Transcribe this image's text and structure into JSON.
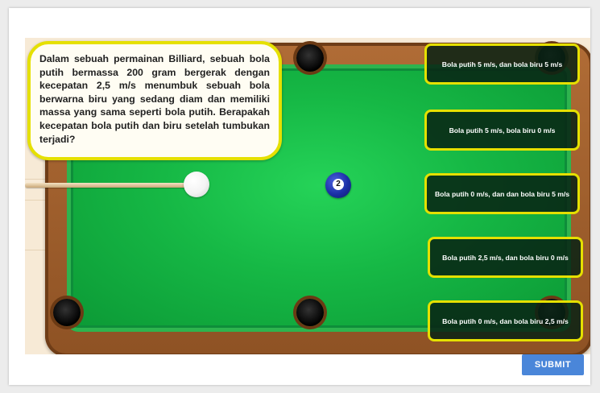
{
  "question": {
    "text": "Dalam sebuah permainan Billiard, sebuah bola putih bermassa 200 gram bergerak dengan kecepatan 2,5 m/s menumbuk sebuah bola berwarna biru yang sedang diam dan memiliki massa yang sama seperti bola putih. Berapakah kecepatan bola putih dan biru setelah tumbukan terjadi?"
  },
  "ball_number": "2",
  "answers": [
    {
      "label": "Bola putih 5 m/s, dan bola biru 5 m/s"
    },
    {
      "label": "Bola putih 5 m/s, bola biru 0 m/s"
    },
    {
      "label": "Bola putih 0 m/s, dan dan bola biru 5 m/s"
    },
    {
      "label": "Bola putih 2,5 m/s, dan bola biru 0 m/s"
    },
    {
      "label": "Bola putih 0 m/s, dan bola biru 2,5 m/s"
    }
  ],
  "submit_label": "SUBMIT",
  "colors": {
    "accent_border": "#e5e000",
    "felt": "#16b845",
    "wood": "#a3622f",
    "submit": "#4a86d9"
  },
  "icons": [
    "cue-stick",
    "cue-ball",
    "blue-ball"
  ]
}
